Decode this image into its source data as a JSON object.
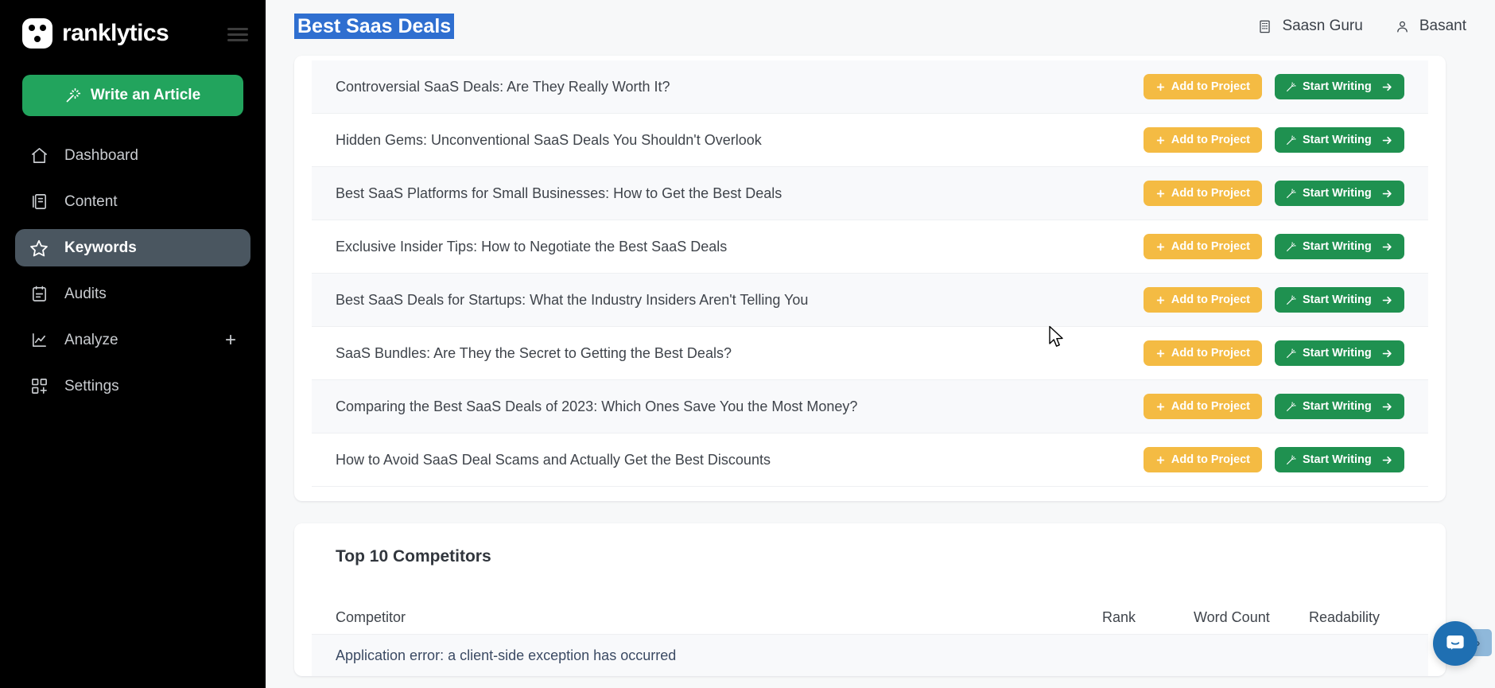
{
  "sidebar": {
    "brand": "ranklytics",
    "menu_icon": "hamburger-icon",
    "write_button": "Write an Article",
    "items": [
      {
        "label": "Dashboard",
        "icon": "home-icon",
        "active": false,
        "plus": false
      },
      {
        "label": "Content",
        "icon": "book-icon",
        "active": false,
        "plus": false
      },
      {
        "label": "Keywords",
        "icon": "star-icon",
        "active": true,
        "plus": false
      },
      {
        "label": "Audits",
        "icon": "clipboard-icon",
        "active": false,
        "plus": false
      },
      {
        "label": "Analyze",
        "icon": "chart-line-icon",
        "active": false,
        "plus": true
      },
      {
        "label": "Settings",
        "icon": "grid-add-icon",
        "active": false,
        "plus": false
      }
    ]
  },
  "topbar": {
    "page_title": "Best Saas Deals",
    "workspace": "Saasn Guru",
    "workspace_icon": "building-icon",
    "user": "Basant",
    "user_icon": "person-icon"
  },
  "ideas": {
    "add_label": "Add to Project",
    "add_icon": "plus-icon",
    "write_label": "Start Writing",
    "write_icon": "magic-wand-icon",
    "write_arrow_icon": "arrow-right-icon",
    "rows": [
      "Controversial SaaS Deals: Are They Really Worth It?",
      "Hidden Gems: Unconventional SaaS Deals You Shouldn't Overlook",
      "Best SaaS Platforms for Small Businesses: How to Get the Best Deals",
      "Exclusive Insider Tips: How to Negotiate the Best SaaS Deals",
      "Best SaaS Deals for Startups: What the Industry Insiders Aren't Telling You",
      "SaaS Bundles: Are They the Secret to Getting the Best Deals?",
      "Comparing the Best SaaS Deals of 2023: Which Ones Save You the Most Money?",
      "How to Avoid SaaS Deal Scams and Actually Get the Best Discounts"
    ]
  },
  "competitors": {
    "title": "Top 10 Competitors",
    "columns": {
      "competitor": "Competitor",
      "rank": "Rank",
      "word_count": "Word Count",
      "readability": "Readability"
    },
    "rows": [
      {
        "competitor": "Application error: a client-side exception has occurred",
        "rank": "",
        "word_count": "",
        "readability": ""
      }
    ]
  },
  "widgets": {
    "chat_icon": "intercom-chat-icon",
    "chat_peek": "›"
  },
  "colors": {
    "sidebar_bg": "#000000",
    "accent_green": "#22a45d",
    "accent_amber": "#f4bb43",
    "selection_blue": "#2f6fd0",
    "chat_blue": "#1f6fb2"
  }
}
